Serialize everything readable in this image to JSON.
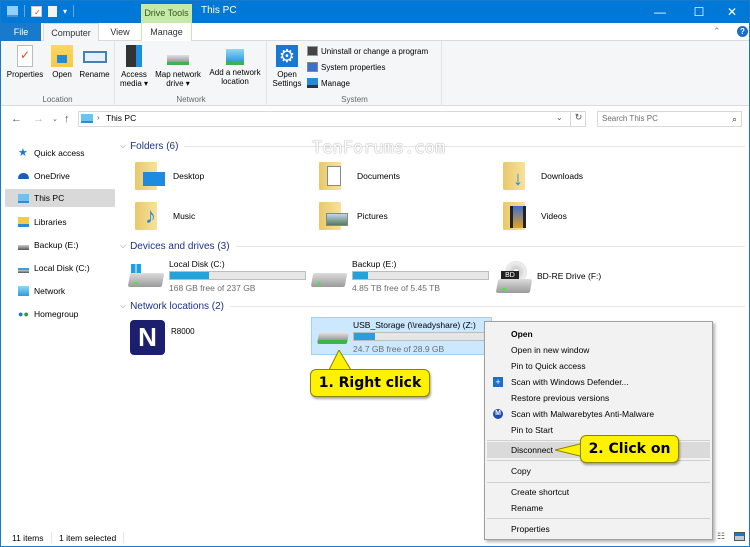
{
  "window": {
    "title": "This PC",
    "context_tab": "Drive Tools",
    "controls": {
      "minimize": "—",
      "maximize": "☐",
      "close": "✕"
    }
  },
  "ribbon_tabs": [
    {
      "label": "File"
    },
    {
      "label": "Computer"
    },
    {
      "label": "View"
    },
    {
      "label": "Manage"
    }
  ],
  "ribbon": {
    "location": {
      "label": "Location",
      "buttons": [
        {
          "label": "Properties",
          "icon": "properties-icon"
        },
        {
          "label": "Open",
          "icon": "open-folder-icon"
        },
        {
          "label": "Rename",
          "icon": "rename-icon"
        }
      ]
    },
    "network": {
      "label": "Network",
      "buttons": [
        {
          "label": "Access media ▾",
          "line1": "Access",
          "line2": "media ▾",
          "icon": "access-media-icon"
        },
        {
          "label": "Map network drive ▾",
          "line1": "Map network",
          "line2": "drive ▾",
          "icon": "map-drive-icon"
        },
        {
          "label": "Add a network location",
          "line1": "Add a network",
          "line2": "location",
          "icon": "add-network-location-icon"
        }
      ]
    },
    "system": {
      "label": "System",
      "open_settings": {
        "line1": "Open",
        "line2": "Settings"
      },
      "items": [
        {
          "label": "Uninstall or change a program"
        },
        {
          "label": "System properties"
        },
        {
          "label": "Manage"
        }
      ]
    }
  },
  "address_bar": {
    "path": "This PC",
    "search_placeholder": "Search This PC"
  },
  "sidebar": {
    "items": [
      {
        "label": "Quick access",
        "icon": "star-icon"
      },
      {
        "label": "OneDrive",
        "icon": "cloud-icon"
      },
      {
        "label": "This PC",
        "icon": "computer-icon",
        "selected": true
      },
      {
        "label": "Libraries",
        "icon": "library-icon"
      },
      {
        "label": "Backup (E:)",
        "icon": "drive-icon"
      },
      {
        "label": "Local Disk (C:)",
        "icon": "drive-icon"
      },
      {
        "label": "Network",
        "icon": "network-icon"
      },
      {
        "label": "Homegroup",
        "icon": "homegroup-icon"
      }
    ]
  },
  "sections": {
    "folders": {
      "title": "Folders (6)",
      "items": [
        {
          "label": "Desktop"
        },
        {
          "label": "Documents"
        },
        {
          "label": "Downloads"
        },
        {
          "label": "Music"
        },
        {
          "label": "Pictures"
        },
        {
          "label": "Videos"
        }
      ]
    },
    "drives": {
      "title": "Devices and drives (3)",
      "items": [
        {
          "label": "Local Disk (C:)",
          "free": "168 GB free of 237 GB",
          "used_fraction": 0.29
        },
        {
          "label": "Backup (E:)",
          "free": "4.85 TB free of 5.45 TB",
          "used_fraction": 0.11
        },
        {
          "label": "BD-RE Drive (F:)"
        }
      ]
    },
    "network": {
      "title": "Network locations (2)",
      "items": [
        {
          "label": "R8000"
        },
        {
          "label": "USB_Storage (\\\\readyshare) (Z:)",
          "free": "24.7 GB free of 28.9 GB",
          "used_fraction": 0.15,
          "selected": true
        }
      ]
    }
  },
  "context_menu": {
    "items": [
      {
        "label": "Open",
        "bold": true
      },
      {
        "label": "Open in new window"
      },
      {
        "label": "Pin to Quick access"
      },
      {
        "label": "Scan with Windows Defender...",
        "icon": "defender-icon"
      },
      {
        "label": "Restore previous versions"
      },
      {
        "label": "Scan with Malwarebytes Anti-Malware",
        "icon": "malwarebytes-icon"
      },
      {
        "label": "Pin to Start"
      },
      {
        "label": "Disconnect",
        "highlighted": true
      },
      {
        "label": "Copy"
      },
      {
        "label": "Create shortcut"
      },
      {
        "label": "Rename"
      },
      {
        "label": "Properties"
      }
    ]
  },
  "callouts": {
    "step1": "1. Right click",
    "step2": "2. Click on"
  },
  "watermark": "TenForums.com",
  "status_bar": {
    "item_count": "11 items",
    "selection": "1 item selected"
  }
}
